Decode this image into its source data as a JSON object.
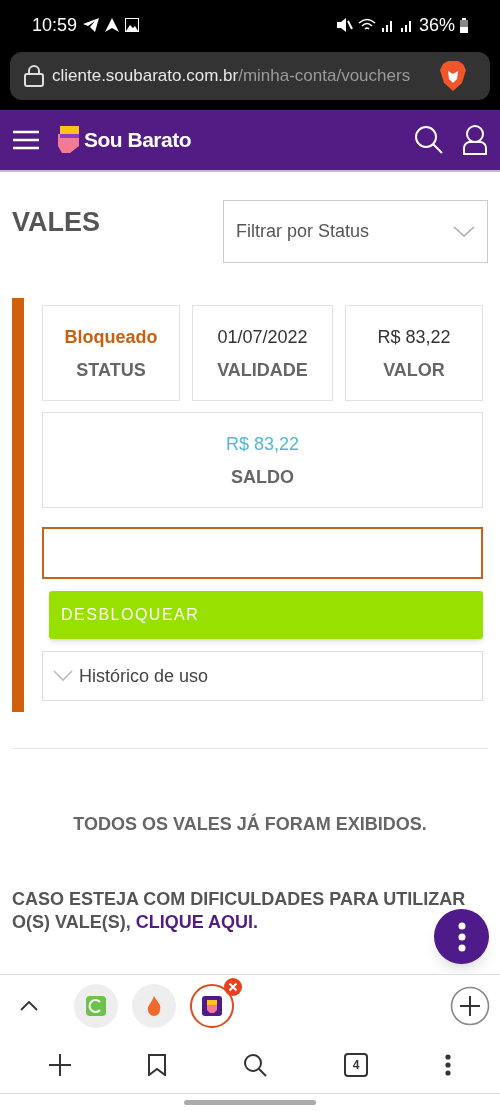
{
  "status_bar": {
    "time": "10:59",
    "battery": "36%"
  },
  "browser": {
    "url_host": "cliente.soubarato.com.br",
    "url_path": "/minha-conta/vouchers"
  },
  "header": {
    "brand": "Sou Barato"
  },
  "page": {
    "title": "VALES",
    "filter": {
      "placeholder": "Filtrar por Status"
    }
  },
  "voucher": {
    "status": "Bloqueado",
    "status_label": "STATUS",
    "validity": "01/07/2022",
    "validity_label": "VALIDADE",
    "value": "R$ 83,22",
    "value_label": "VALOR",
    "balance": "R$ 83,22",
    "balance_label": "SALDO",
    "unlock_button": "DESBLOQUEAR",
    "history": {
      "label": "Histórico de uso",
      "expanded": false
    }
  },
  "end_message": "TODOS OS VALES JÁ FORAM EXIBIDOS.",
  "help": {
    "text": "CASO ESTEJA COM DIFICULDADES PARA UTILIZAR O(S) VALE(S), ",
    "link": "CLIQUE AQUI."
  },
  "tab_strip": {
    "tabs": [
      {
        "kind": "green",
        "selected": false
      },
      {
        "kind": "flame",
        "selected": false
      },
      {
        "kind": "soubarato",
        "selected": true
      }
    ]
  },
  "toolbar": {
    "tab_count": "4"
  }
}
